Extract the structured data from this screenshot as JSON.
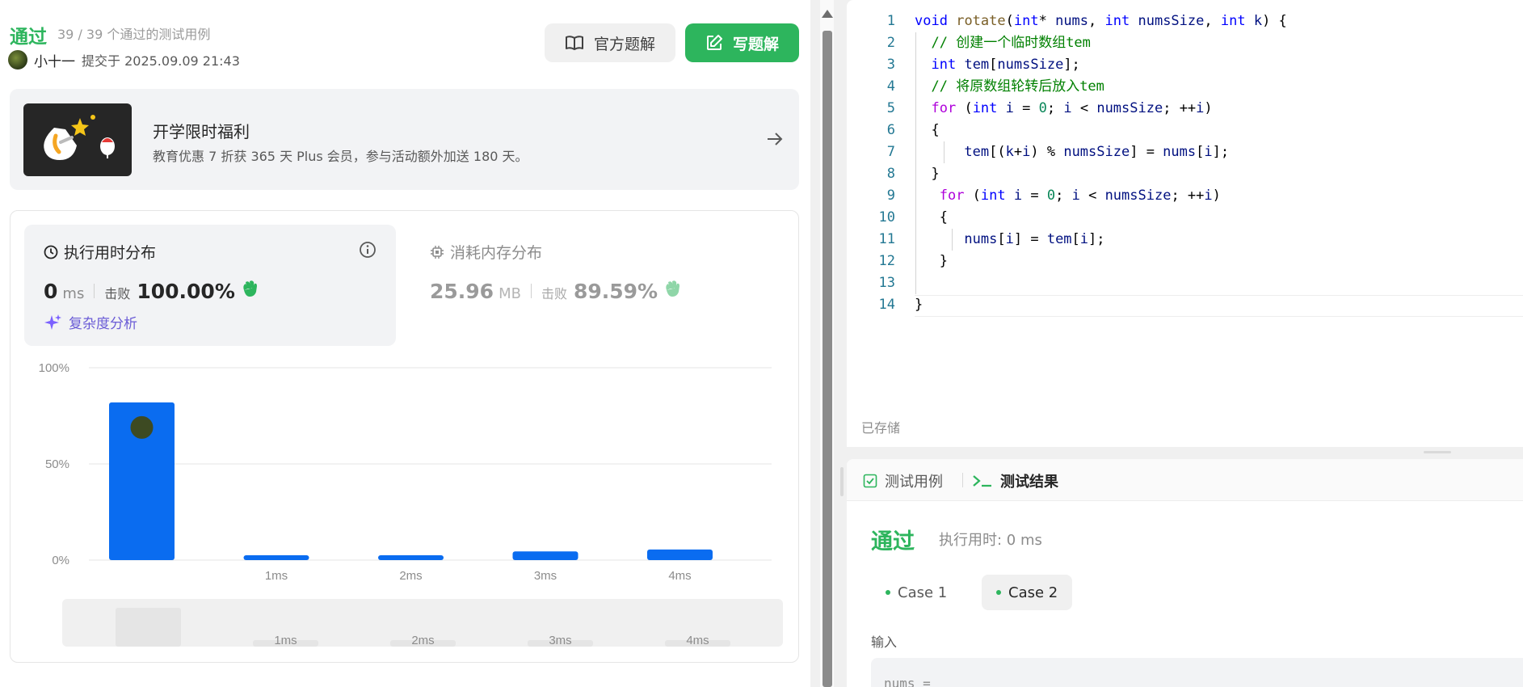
{
  "submission": {
    "status": "通过",
    "summary": "39 / 39 个通过的测试用例",
    "username": "小十一",
    "submitted": "提交于 2025.09.09 21:43"
  },
  "buttons": {
    "official": "官方题解",
    "write": "写题解"
  },
  "promo": {
    "title": "开学限时福利",
    "desc": "教育优惠 7 折获 365 天 Plus 会员，参与活动额外加送 180 天。"
  },
  "runtime": {
    "label": "执行用时分布",
    "value": "0",
    "unit": "ms",
    "beat_label": "击败",
    "beat": "100.00%",
    "complexity": "复杂度分析"
  },
  "memory": {
    "label": "消耗内存分布",
    "value": "25.96",
    "unit": "MB",
    "beat_label": "击败",
    "beat": "89.59%"
  },
  "chart_data": {
    "type": "bar",
    "categories": [
      "",
      "1ms",
      "2ms",
      "3ms",
      "4ms"
    ],
    "values": [
      82,
      2.5,
      2.5,
      4.5,
      5.5
    ],
    "ylim": [
      0,
      100
    ],
    "yticks": [
      "0%",
      "50%",
      "100%"
    ],
    "highlight_index": 0,
    "minimap_labels": [
      "1ms",
      "2ms",
      "3ms",
      "4ms"
    ],
    "colors": {
      "bar": "#0a6cf0",
      "minimap": "#e5e5e5"
    }
  },
  "code": [
    "void rotate(int* nums, int numsSize, int k) {",
    "  // 创建一个临时数组tem",
    "  int tem[numsSize];",
    "  // 将原数组轮转后放入tem",
    "  for (int i = 0; i < numsSize; ++i)",
    "  {",
    "      tem[(k+i) % numsSize] = nums[i];",
    "  }",
    "   for (int i = 0; i < numsSize; ++i)",
    "   {",
    "      nums[i] = tem[i];",
    "   }",
    "",
    "}"
  ],
  "editor": {
    "saved": "已存储"
  },
  "console": {
    "tab_cases": "测试用例",
    "tab_result": "测试结果",
    "result": "通过",
    "time": "执行用时: 0 ms",
    "cases": [
      "Case 1",
      "Case 2"
    ],
    "input_label": "输入",
    "input_first": "nums ="
  },
  "colors": {
    "accent": "#2db55d",
    "chart_bar": "#0a6cf0",
    "complexity": "#6b5cd6"
  }
}
